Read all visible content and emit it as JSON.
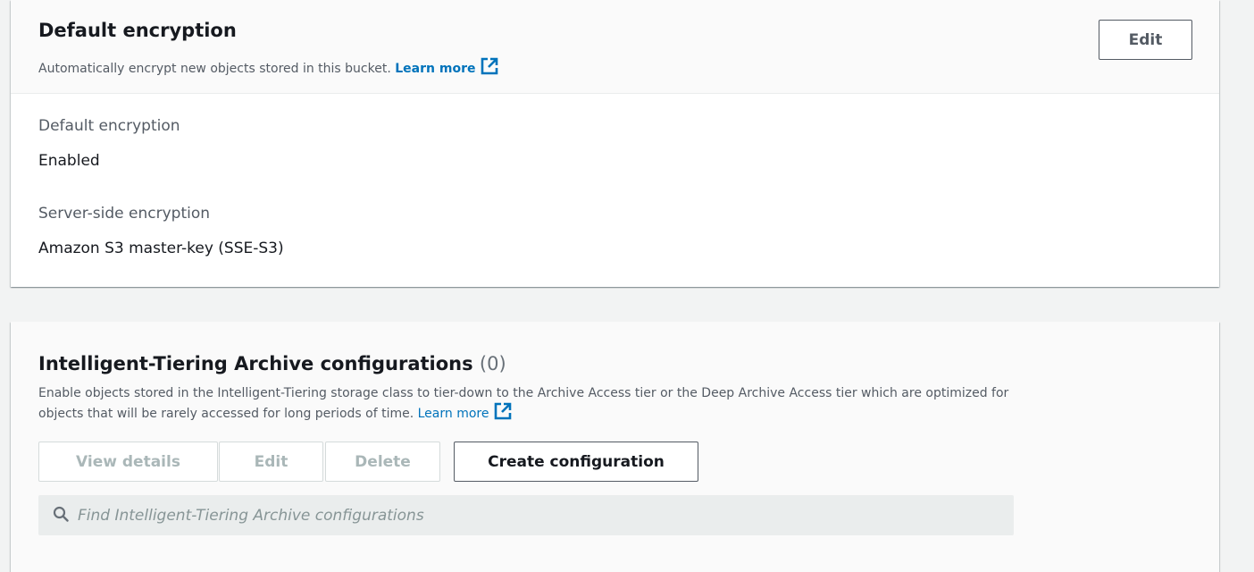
{
  "encryption": {
    "title": "Default encryption",
    "description": "Automatically encrypt new objects stored in this bucket.",
    "learn_more": "Learn more",
    "edit_label": "Edit",
    "fields": [
      {
        "label": "Default encryption",
        "value": "Enabled"
      },
      {
        "label": "Server-side encryption",
        "value": "Amazon S3 master-key (SSE-S3)"
      }
    ]
  },
  "tiering": {
    "title": "Intelligent-Tiering Archive configurations",
    "count": "(0)",
    "description_line1": "Enable objects stored in the Intelligent-Tiering storage class to tier-down to the Archive Access tier or the Deep Archive Access tier which are optimized for",
    "description_line2": "objects that will be rarely accessed for long periods of time.",
    "learn_more": "Learn more",
    "buttons": {
      "view_details": "View details",
      "edit": "Edit",
      "delete": "Delete",
      "create": "Create configuration"
    },
    "search_placeholder": "Find Intelligent-Tiering Archive configurations"
  },
  "colors": {
    "link": "#0073bb",
    "background": "#f2f3f3",
    "disabled_text": "#aab7b8"
  }
}
